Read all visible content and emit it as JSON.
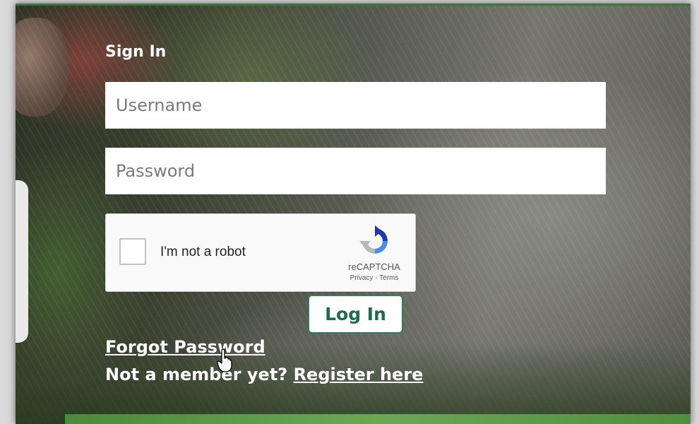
{
  "signin": {
    "title": "Sign In",
    "username_placeholder": "Username",
    "password_placeholder": "Password",
    "login_label": "Log In"
  },
  "recaptcha": {
    "label": "I'm not a robot",
    "brand": "reCAPTCHA",
    "privacy": "Privacy",
    "separator": " - ",
    "terms": "Terms"
  },
  "links": {
    "forgot_password": "Forgot Password",
    "not_member": "Not a member yet?",
    "register": "Register here"
  },
  "icons": {
    "recaptcha_logo": "recaptcha-logo-icon",
    "cursor": "hand-pointer-cursor-icon"
  },
  "colors": {
    "accent_green": "#2e7d32",
    "button_text_green": "#1f6b47",
    "recaptcha_blue": "#1c3aa9",
    "recaptcha_light_blue": "#4a90e2",
    "recaptcha_gray": "#b8b8b8"
  }
}
